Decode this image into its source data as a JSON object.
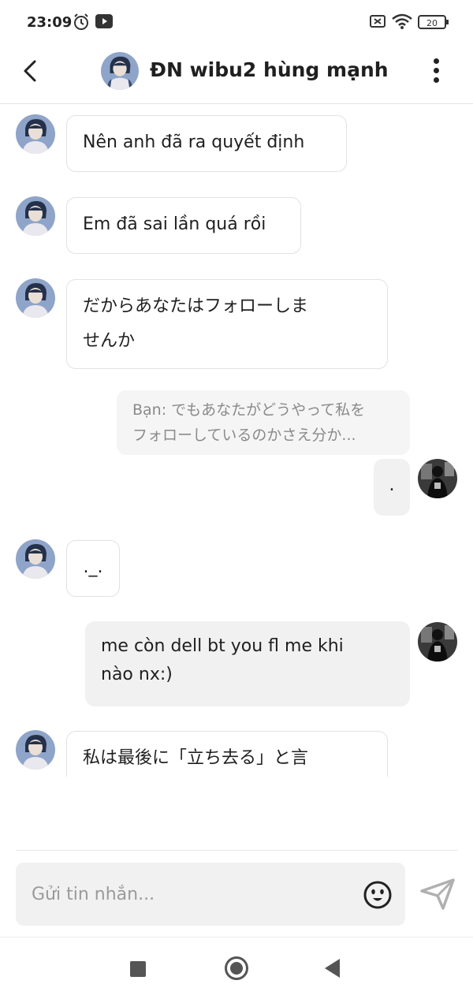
{
  "status_bar": {
    "time": "23:09",
    "left_icons": [
      "alarm-icon",
      "youtube-icon"
    ],
    "right_icons": [
      "sim-off-icon",
      "wifi-icon",
      "battery-icon"
    ],
    "battery_level": "20"
  },
  "header": {
    "title": "ĐN wibu2 hùng mạnh",
    "back_icon": "chevron-left-icon",
    "menu_icon": "more-vertical-icon"
  },
  "messages": [
    {
      "side": "in",
      "text": "Nên anh đã ra quyết định"
    },
    {
      "side": "in",
      "text": "Em đã sai lần quá rồi"
    },
    {
      "side": "in",
      "lines": [
        "だからあなたはフォローしま",
        "せんか"
      ]
    },
    {
      "side": "out",
      "reply_quote_lines": [
        "Bạn: でもあなたがどうやって私を",
        "フォローしているのかさえ分か..."
      ],
      "text": "."
    },
    {
      "side": "in",
      "text": "._."
    },
    {
      "side": "out",
      "lines": [
        "me còn dell bt you fl me khi",
        "nào nx:)"
      ]
    },
    {
      "side": "in",
      "text": "私は最後に「立ち去る」と言"
    }
  ],
  "composer": {
    "placeholder": "Gửi tin nhắn...",
    "emoji_icon": "emoji-icon",
    "send_icon": "send-icon"
  },
  "nav_bar": {
    "icons": [
      "recent-apps-icon",
      "home-icon",
      "back-icon"
    ]
  },
  "colors": {
    "incoming_bubble_border": "#e2e2e2",
    "outgoing_bubble_bg": "#f1f1f1",
    "reply_quote_text": "#8a8a8a",
    "avatar_bg": "#8fa4c9"
  }
}
